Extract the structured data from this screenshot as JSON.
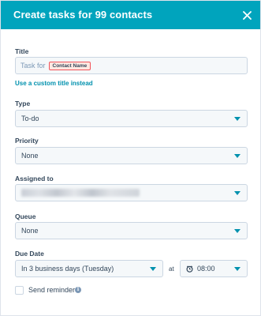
{
  "header": {
    "title": "Create tasks for 99 contacts"
  },
  "title_field": {
    "label": "Title",
    "prefix": "Task for",
    "token": "Contact Name",
    "custom_link": "Use a custom title instead"
  },
  "type_field": {
    "label": "Type",
    "value": "To-do"
  },
  "priority_field": {
    "label": "Priority",
    "value": "None"
  },
  "assigned_field": {
    "label": "Assigned to"
  },
  "queue_field": {
    "label": "Queue",
    "value": "None"
  },
  "due_date": {
    "label": "Due Date",
    "date_value": "In 3 business days (Tuesday)",
    "at_label": "at",
    "time_value": "08:00"
  },
  "reminder": {
    "label": "Send reminder",
    "checked": false
  },
  "colors": {
    "header": "#00a4bd",
    "link": "#0091ae",
    "token_border": "#f2545b"
  },
  "icons": {
    "close": "close-icon",
    "clock": "clock-icon",
    "info": "info-icon",
    "dropdown": "chevron-down-icon"
  }
}
